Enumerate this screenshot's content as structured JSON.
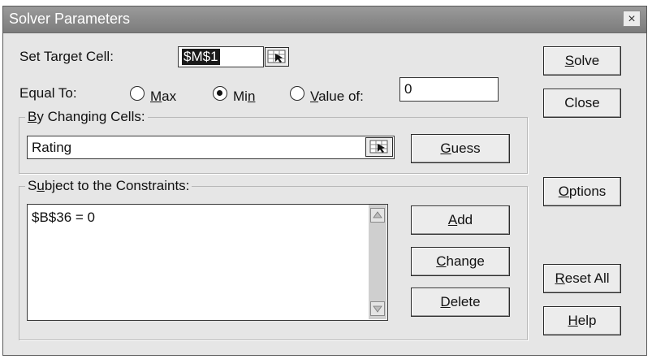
{
  "window": {
    "title": "Solver Parameters",
    "close_label": "×"
  },
  "target": {
    "label_text": "Set Target Cell:",
    "value": "$M$1"
  },
  "equal_to": {
    "label_text": "Equal To:",
    "options": [
      {
        "pre": "",
        "accel": "M",
        "post": "ax",
        "selected": false
      },
      {
        "pre": "Mi",
        "accel": "n",
        "post": "",
        "selected": true
      },
      {
        "pre": "",
        "accel": "V",
        "post": "alue of:",
        "selected": false
      }
    ],
    "value_of": "0"
  },
  "changing": {
    "label_pre": "",
    "label_accel": "B",
    "label_post": "y Changing Cells:",
    "value": "Rating",
    "guess": {
      "pre": "",
      "accel": "G",
      "post": "uess"
    }
  },
  "constraints": {
    "label_pre": "S",
    "label_accel": "u",
    "label_post": "bject to the Constraints:",
    "items": [
      "$B$36 = 0"
    ],
    "add": {
      "pre": "",
      "accel": "A",
      "post": "dd"
    },
    "change": {
      "pre": "",
      "accel": "C",
      "post": "hange"
    },
    "delete": {
      "pre": "",
      "accel": "D",
      "post": "elete"
    }
  },
  "side_buttons": {
    "solve": {
      "pre": "",
      "accel": "S",
      "post": "olve"
    },
    "close": {
      "pre": "Close",
      "accel": "",
      "post": ""
    },
    "options": {
      "pre": "",
      "accel": "O",
      "post": "ptions"
    },
    "reset": {
      "pre": "",
      "accel": "R",
      "post": "eset All"
    },
    "help": {
      "pre": "",
      "accel": "H",
      "post": "elp"
    }
  },
  "icons": {
    "cell_picker": "cell-picker-icon",
    "scroll_up": "triangle-up-icon",
    "scroll_down": "triangle-down-icon",
    "close": "close-icon"
  },
  "colors": {
    "titlebar": "#8a8a8a",
    "dialog": "#e6e6e6",
    "selection": "#1a1a1a"
  }
}
